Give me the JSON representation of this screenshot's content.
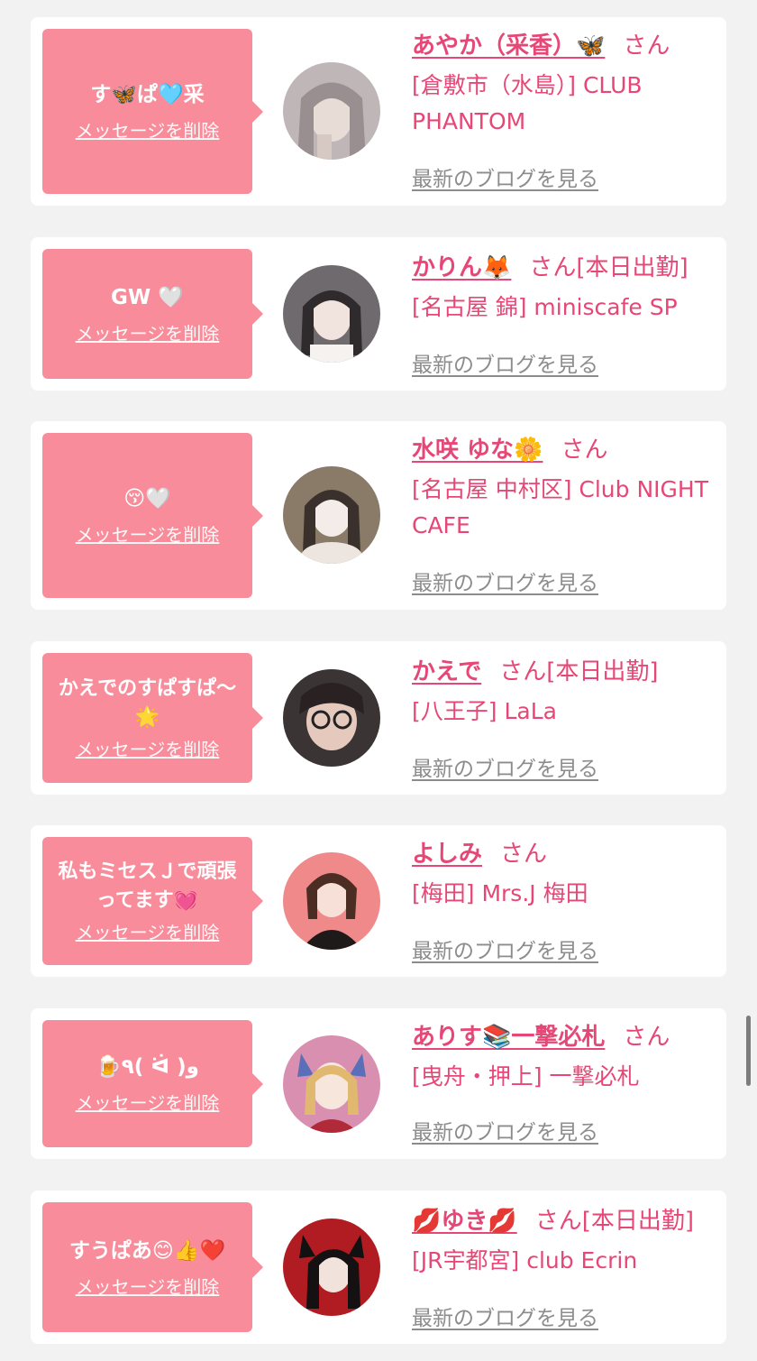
{
  "delete_label": "メッセージを削除",
  "blog_label": "最新のブログを見る",
  "colors": {
    "background": "#f2f2f2",
    "card": "#ffffff",
    "bubble": "#f98c9a",
    "name": "#e64776",
    "link_gray": "#8c8c8c"
  },
  "entries": [
    {
      "message": "す🦋ぱ🩵采",
      "name": "あやか（采香）🦋",
      "honorific": "さん",
      "status": "",
      "shop": "[倉敷市（水島）] CLUB PHANTOM",
      "avatar_icon": "profile-photo"
    },
    {
      "message": "GW 🤍",
      "name": "かりん🦊",
      "honorific": "さん",
      "status": "[本日出勤]",
      "shop": "[名古屋 錦] miniscafe SP",
      "avatar_icon": "profile-photo"
    },
    {
      "message": "😚🤍",
      "name": "水咲 ゆな🌼",
      "honorific": "さん",
      "status": "",
      "shop": "[名古屋 中村区] Club NIGHT CAFE",
      "avatar_icon": "profile-photo"
    },
    {
      "message": "かえでのすぱすぱ〜🌟",
      "name": "かえで",
      "honorific": "さん",
      "status": "[本日出勤]",
      "shop": "[八王子] LaLa",
      "avatar_icon": "profile-photo"
    },
    {
      "message": "私もミセスＪで頑張ってます💓",
      "name": "よしみ",
      "honorific": "さん",
      "status": "",
      "shop": "[梅田] Mrs.J 梅田",
      "avatar_icon": "profile-photo"
    },
    {
      "message": "🍺٩( ᐛ )و",
      "name": "ありす📚一撃必札",
      "honorific": "さん",
      "status": "",
      "shop": "[曳舟・押上] 一撃必札",
      "avatar_icon": "profile-photo"
    },
    {
      "message": "すうぱあ😊👍❤️",
      "name": "💋ゆき💋",
      "honorific": "さん",
      "status": "[本日出勤]",
      "shop": "[JR宇都宮] club Ecrin",
      "avatar_icon": "profile-photo"
    }
  ]
}
